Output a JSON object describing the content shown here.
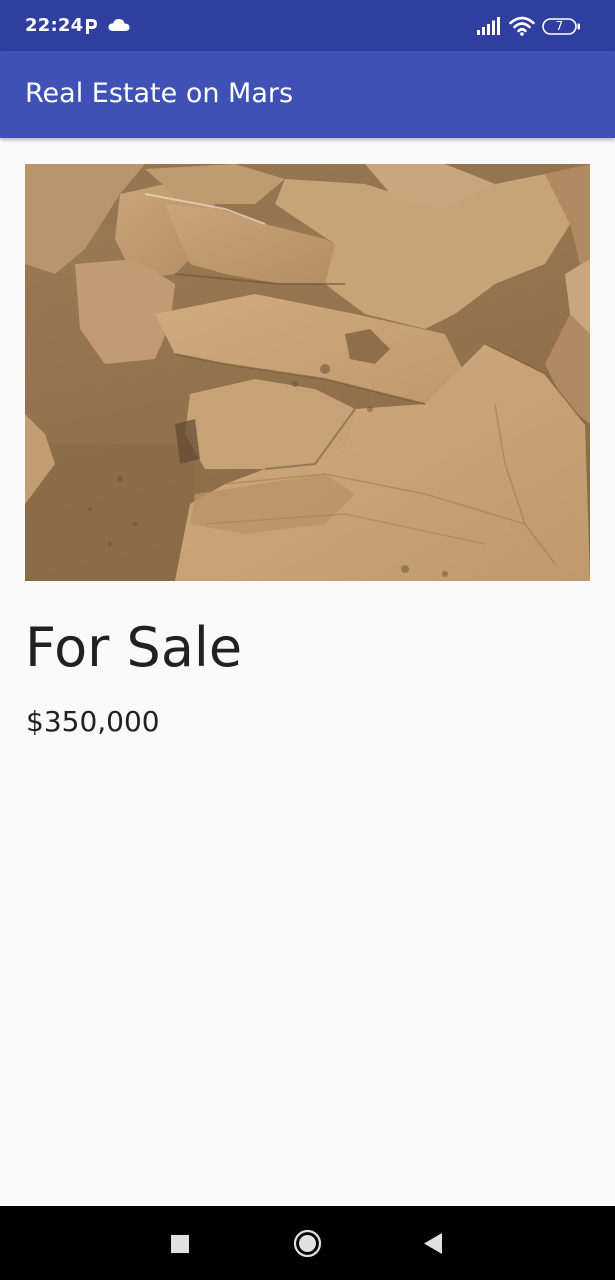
{
  "status_bar": {
    "time": "22:24",
    "battery_level": "7",
    "icons": [
      "parking-notification-icon",
      "cloud-icon",
      "signal-icon",
      "wifi-icon",
      "battery-icon"
    ],
    "background_color": "#303f9f"
  },
  "app_bar": {
    "title": "Real Estate on Mars",
    "background_color": "#3f51b5"
  },
  "property": {
    "image_description": "Mars surface rock",
    "type_label": "For Sale",
    "price": "$350,000"
  },
  "nav_bar": {
    "icons": [
      "recents-square-icon",
      "home-circle-icon",
      "back-triangle-icon"
    ]
  }
}
